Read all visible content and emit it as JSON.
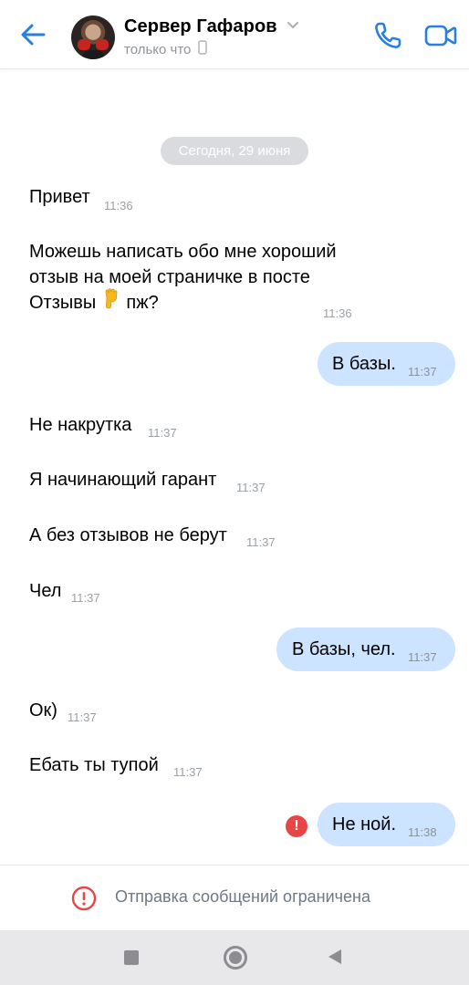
{
  "header": {
    "contact_name": "Сервер Гафаров",
    "status": "только что"
  },
  "date_separator": "Сегодня, 29 июня",
  "messages": [
    {
      "side": "in",
      "lines": [
        "Привет"
      ],
      "time": "11:36"
    },
    {
      "side": "in",
      "lines": [
        "Можешь написать обо мне хороший",
        "отзыв на моей страничке в посте",
        "Отзывы",
        "пж?"
      ],
      "emoji": "backhand-index-pointing-down",
      "time": "11:36"
    },
    {
      "side": "out",
      "lines": [
        "В базы."
      ],
      "time": "11:37"
    },
    {
      "side": "in",
      "lines": [
        "Не накрутка"
      ],
      "time": "11:37"
    },
    {
      "side": "in",
      "lines": [
        "Я начинающий гарант"
      ],
      "time": "11:37"
    },
    {
      "side": "in",
      "lines": [
        "А без отзывов не берут"
      ],
      "time": "11:37"
    },
    {
      "side": "in",
      "lines": [
        "Чел"
      ],
      "time": "11:37"
    },
    {
      "side": "out",
      "lines": [
        "В базы, чел."
      ],
      "time": "11:37"
    },
    {
      "side": "in",
      "lines": [
        "Ок)"
      ],
      "time": "11:37"
    },
    {
      "side": "in",
      "lines": [
        "Ебать ты тупой"
      ],
      "time": "11:37"
    },
    {
      "side": "out",
      "lines": [
        "Не ной."
      ],
      "time": "11:38",
      "failed": true
    }
  ],
  "footer": {
    "restricted_text": "Отправка сообщений ограничена"
  },
  "colors": {
    "accent": "#2a7de1",
    "outgoing_bubble": "#cce4ff",
    "error": "#e64646",
    "date_pill": "#dadbde"
  },
  "icons": [
    "back-arrow-icon",
    "chevron-down-icon",
    "phone-small-icon",
    "call-icon",
    "video-call-icon",
    "error-icon",
    "restricted-icon",
    "nav-recents-icon",
    "nav-home-icon",
    "nav-back-icon"
  ]
}
